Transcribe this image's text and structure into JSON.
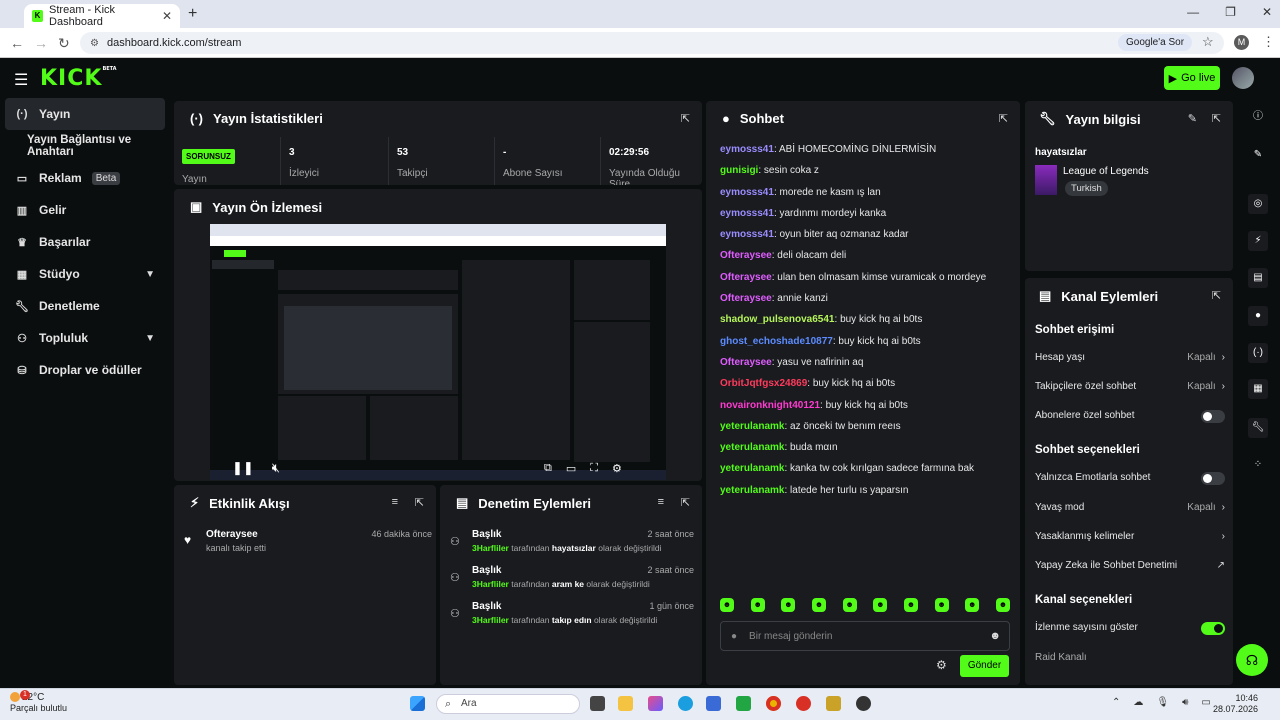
{
  "browser": {
    "tab_title": "Stream - Kick Dashboard",
    "url": "dashboard.kick.com/stream",
    "google_sor": "Google'a Sor",
    "profile_initial": "M"
  },
  "header": {
    "logo": "KICK",
    "logo_badge": "BETA",
    "go_live": "Go live"
  },
  "sidebar": {
    "items": [
      {
        "label": "Yayın",
        "icon": "stream-icon"
      },
      {
        "label": "Yayın Bağlantısı ve Anahtarı"
      },
      {
        "label": "Reklam",
        "icon": "ad-icon",
        "badge": "Beta"
      },
      {
        "label": "Gelir",
        "icon": "chart-icon"
      },
      {
        "label": "Başarılar",
        "icon": "trophy-icon"
      },
      {
        "label": "Stüdyo",
        "icon": "studio-icon"
      },
      {
        "label": "Denetleme",
        "icon": "wrench-icon"
      },
      {
        "label": "Topluluk",
        "icon": "people-icon"
      },
      {
        "label": "Droplar ve ödüller",
        "icon": "drops-icon"
      }
    ]
  },
  "stats": {
    "title": "Yayın İstatistikleri",
    "status": "SORUNSUZ",
    "status_label": "Yayın",
    "items": [
      {
        "value": "3",
        "label": "İzleyici"
      },
      {
        "value": "53",
        "label": "Takipçi"
      },
      {
        "value": "-",
        "label": "Abone Sayısı"
      },
      {
        "value": "02:29:56",
        "label": "Yayında Olduğu Süre"
      }
    ]
  },
  "preview": {
    "title": "Yayın Ön İzlemesi"
  },
  "events": {
    "title": "Etkinlik Akışı",
    "items": [
      {
        "user": "Ofteraysee",
        "action": "kanalı takip etti",
        "time": "46 dakika önce"
      }
    ]
  },
  "moderation": {
    "title": "Denetim Eylemleri",
    "items": [
      {
        "heading": "Başlık",
        "actor": "3Harfliler",
        "mid": "tarafından",
        "value": "hayatsızlar",
        "tail": "olarak değiştirildi",
        "time": "2 saat önce"
      },
      {
        "heading": "Başlık",
        "actor": "3Harfliler",
        "mid": "tarafından",
        "value": "aram ke",
        "tail": "olarak değiştirildi",
        "time": "2 saat önce"
      },
      {
        "heading": "Başlık",
        "actor": "3Harfliler",
        "mid": "tarafından",
        "value": "takıp edın",
        "tail": "olarak değiştirildi",
        "time": "1 gün önce"
      }
    ]
  },
  "chat": {
    "title": "Sohbet",
    "messages": [
      {
        "user": "eymosss41",
        "color": "#9b8cff",
        "text": "ABİ HOMECOMİNG DİNLERMİSİN"
      },
      {
        "user": "gunisigi",
        "color": "#53fc18",
        "text": "sesin coka z"
      },
      {
        "user": "eymosss41",
        "color": "#9b8cff",
        "text": "morede ne kasm ış lan"
      },
      {
        "user": "eymosss41",
        "color": "#9b8cff",
        "text": "yardınmı mordeyi kanka"
      },
      {
        "user": "eymosss41",
        "color": "#9b8cff",
        "text": "oyun biter aq ozmanaz kadar"
      },
      {
        "user": "Ofteraysee",
        "color": "#e05cff",
        "text": "deli olacam deli"
      },
      {
        "user": "Ofteraysee",
        "color": "#e05cff",
        "text": "ulan ben olmasam kimse vuramicak o mordeye"
      },
      {
        "user": "Ofteraysee",
        "color": "#e05cff",
        "text": "annie kanzi"
      },
      {
        "user": "shadow_pulsenova6541",
        "color": "#b5f55a",
        "text": "buy kick hq ai b0ts"
      },
      {
        "user": "ghost_echoshade10877",
        "color": "#5c8cff",
        "text": "buy kick hq ai b0ts"
      },
      {
        "user": "Ofteraysee",
        "color": "#e05cff",
        "text": "yasu ve nafirinin aq"
      },
      {
        "user": "OrbitJqtfgsx24869",
        "color": "#ff3b5c",
        "text": "buy kick hq ai b0ts"
      },
      {
        "user": "novaironknight40121",
        "color": "#ff3bd0",
        "text": "buy kick hq ai b0ts"
      },
      {
        "user": "yeterulanamk",
        "color": "#53fc18",
        "text": "az önceki tw benım reeıs"
      },
      {
        "user": "yeterulanamk",
        "color": "#53fc18",
        "text": "buda mαın"
      },
      {
        "user": "yeterulanamk",
        "color": "#53fc18",
        "text": "kanka tw cok kırılgan sadece farmına bak"
      },
      {
        "user": "yeterulanamk",
        "color": "#53fc18",
        "text": "latede her turlu ıs yaparsın"
      }
    ],
    "input_placeholder": "Bir mesaj gönderin",
    "send": "Gönder"
  },
  "stream_info": {
    "title": "Yayın bilgisi",
    "stream_title": "hayatsızlar",
    "category": "League of Legends",
    "language": "Turkish"
  },
  "channel_actions": {
    "title": "Kanal Eylemleri",
    "chat_access": "Sohbet erişimi",
    "account_age": "Hesap yaşı",
    "account_age_val": "Kapalı",
    "followers_only": "Takipçilere özel sohbet",
    "followers_only_val": "Kapalı",
    "subs_only": "Abonelere özel sohbet",
    "chat_options": "Sohbet seçenekleri",
    "emote_only": "Yalnızca Emotlarla sohbet",
    "slow_mode": "Yavaş mod",
    "slow_mode_val": "Kapalı",
    "banned_words": "Yasaklanmış kelimeler",
    "ai_mod": "Yapay Zeka ile Sohbet Denetimi",
    "channel_options": "Kanal seçenekleri",
    "show_views": "İzlenme sayısını göster",
    "raid": "Raid Kanalı"
  },
  "taskbar": {
    "temp": "22°C",
    "weather": "Parçalı bulutlu",
    "search": "Ara",
    "time": "10:46",
    "date": "28.07.2026",
    "badge": "1"
  }
}
